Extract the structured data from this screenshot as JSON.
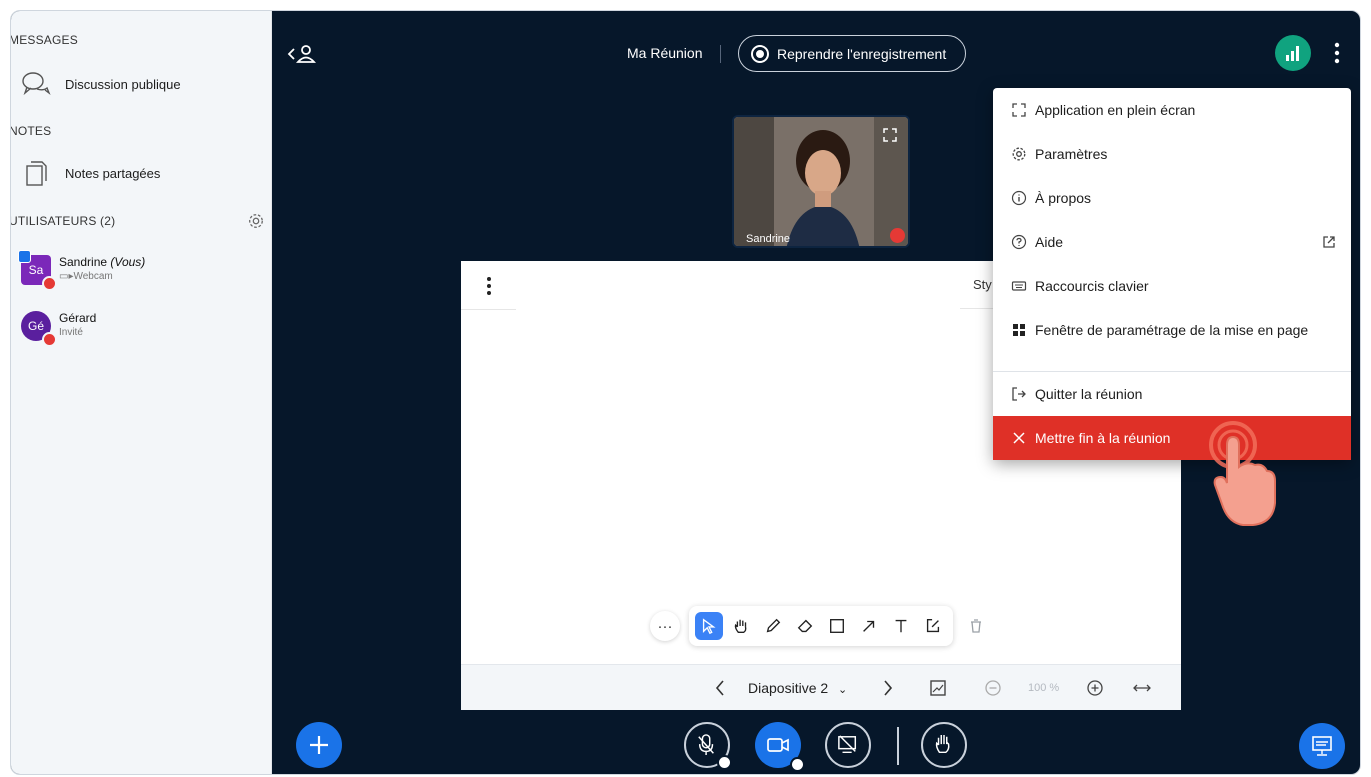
{
  "sidebar": {
    "messages_heading": "MESSAGES",
    "public_chat_label": "Discussion publique",
    "notes_heading": "NOTES",
    "shared_notes_label": "Notes partagées",
    "users_heading": "UTILISATEURS (2)",
    "users": [
      {
        "initials": "Sa",
        "name": "Sandrine",
        "you_label": "(Vous)",
        "sub": "Webcam"
      },
      {
        "initials": "Gé",
        "name": "Gérard",
        "sub": "Invité"
      }
    ]
  },
  "topbar": {
    "meeting_title": "Ma Réunion",
    "record_label": "Reprendre l'enregistrement"
  },
  "video": {
    "name": "Sandrine"
  },
  "whiteboard": {
    "style_tab": "Sty",
    "more_label": "···",
    "slide_label": "Diapositive 2",
    "zoom_label": "100 %"
  },
  "menu": {
    "items": [
      "Application en plein écran",
      "Paramètres",
      "À propos",
      "Aide",
      "Raccourcis clavier",
      "Fenêtre de paramétrage de la mise en page"
    ],
    "leave_label": "Quitter la réunion",
    "end_label": "Mettre fin à la réunion"
  },
  "colors": {
    "stage_bg": "#06172a",
    "accent_blue": "#1a73e8",
    "danger_red": "#df3027",
    "connection_green": "#10a37f"
  }
}
